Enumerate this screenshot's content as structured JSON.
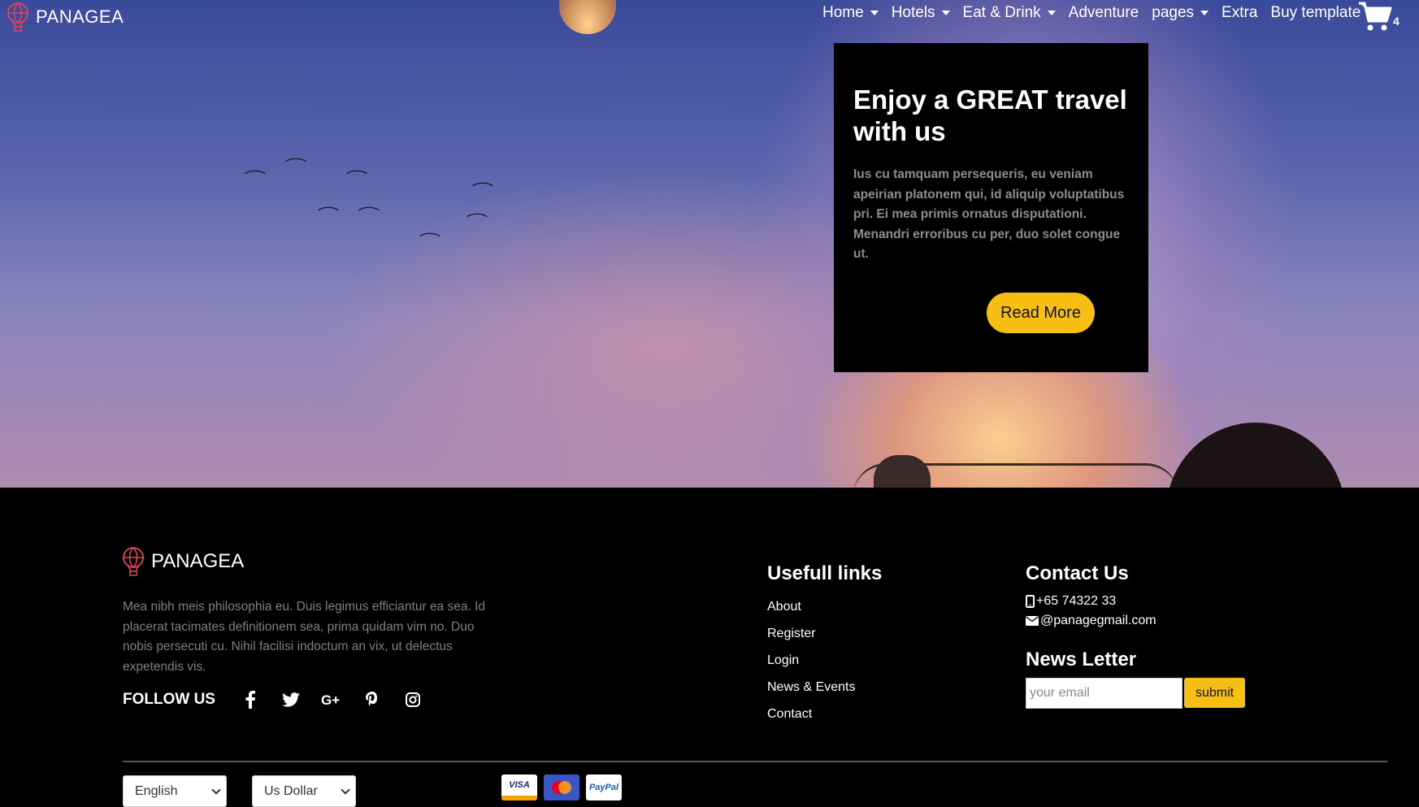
{
  "brand": {
    "name": "PANAGEA",
    "accent": "#e8435a"
  },
  "nav": {
    "items": [
      {
        "label": "Home",
        "dropdown": true
      },
      {
        "label": "Hotels",
        "dropdown": true
      },
      {
        "label": "Eat & Drink",
        "dropdown": true
      },
      {
        "label": "Adventure",
        "dropdown": false
      },
      {
        "label": "pages",
        "dropdown": true
      },
      {
        "label": "Extra",
        "dropdown": false
      },
      {
        "label": "Buy template",
        "dropdown": false
      }
    ],
    "cart_count": "4",
    "cart_icon": "shopping-cart-icon"
  },
  "hero": {
    "title": "Enjoy a GREAT travel with us",
    "text": "Ius cu tamquam persequeris, eu veniam apeirian platonem qui, id aliquip voluptatibus pri. Ei mea primis ornatus disputationi. Menandri erroribus cu per, duo solet congue ut.",
    "button": "Read More",
    "button_color": "#f7bf13"
  },
  "footer": {
    "brand": "PANAGEA",
    "description": "Mea nibh meis philosophia eu. Duis legimus efficiantur ea sea. Id placerat tacimates definitionem sea, prima quidam vim no. Duo nobis persecuti cu. Nihil facilisi indoctum an vix, ut delectus expetendis vis.",
    "follow_label": "FOLLOW US",
    "social": [
      "facebook-icon",
      "twitter-icon",
      "google-plus-icon",
      "pinterest-icon",
      "instagram-icon"
    ],
    "links_title": "Usefull links",
    "links": [
      "About",
      "Register",
      "Login",
      "News & Events",
      "Contact"
    ],
    "contact_title": "Contact Us",
    "phone": "+65 74322 33",
    "email": "@panagegmail.com",
    "newsletter_title": "News Letter",
    "newsletter_placeholder": "your email",
    "newsletter_button": "submit",
    "language": "English",
    "currency": "Us Dollar",
    "payments": [
      "VISA",
      "mastercard",
      "PayPal"
    ]
  }
}
